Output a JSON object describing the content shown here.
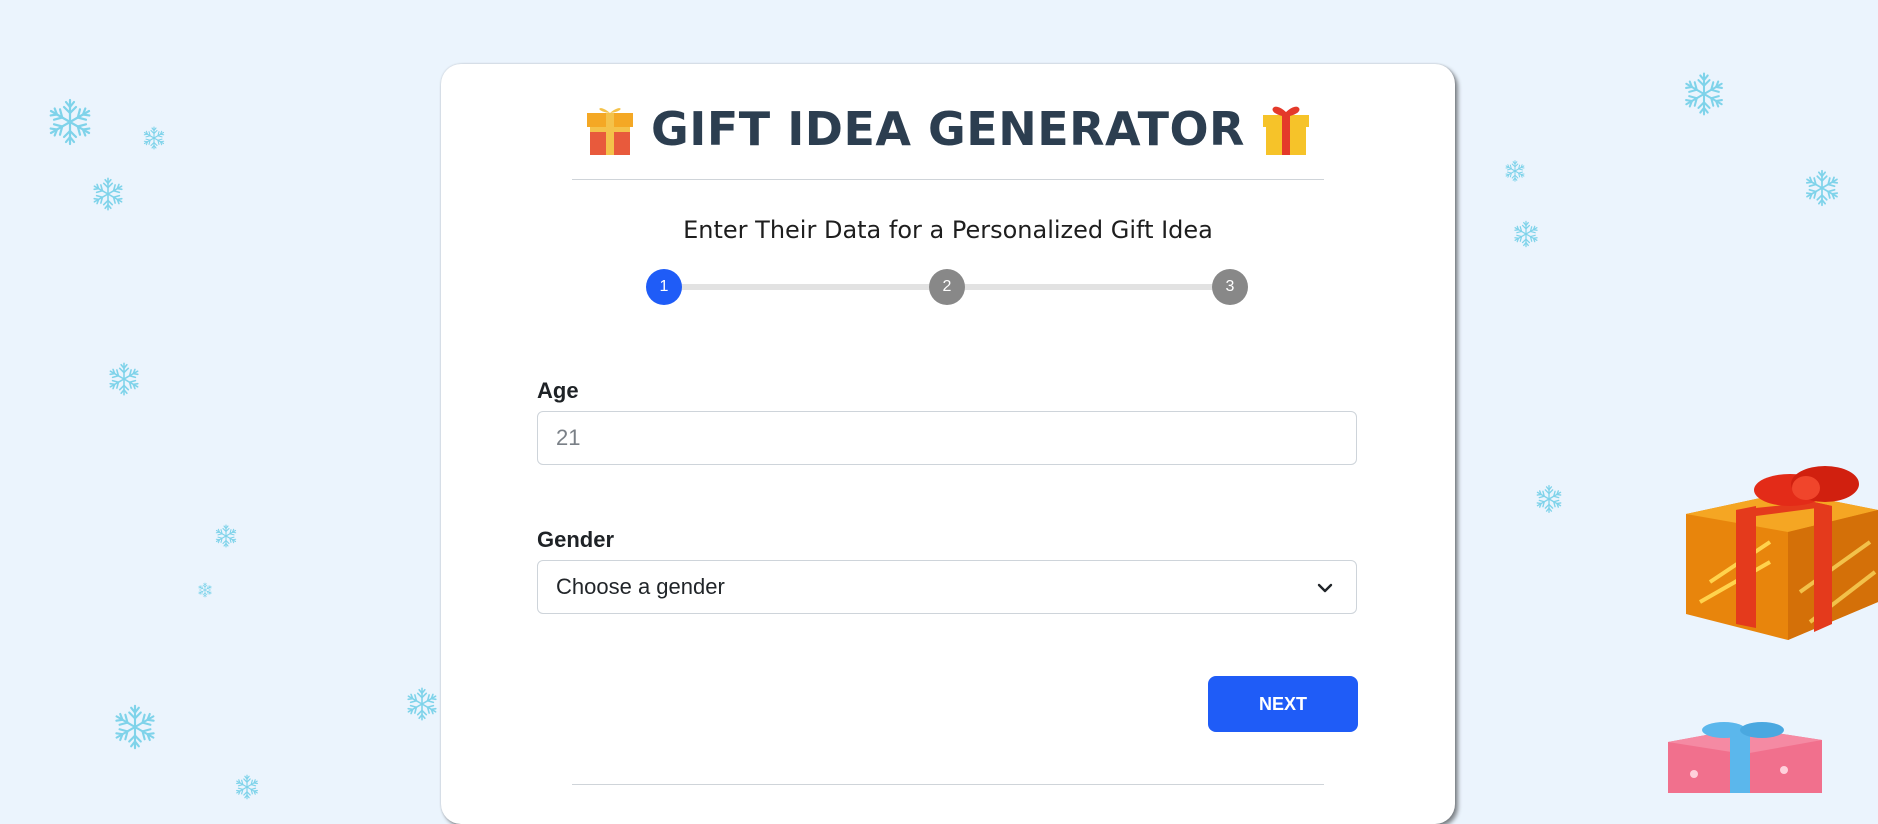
{
  "header": {
    "title": "GIFT IDEA GENERATOR",
    "left_icon": "gift-icon",
    "right_icon": "gift-icon"
  },
  "subtitle": "Enter Their Data for a Personalized Gift Idea",
  "stepper": {
    "steps": [
      "1",
      "2",
      "3"
    ],
    "current_step": 1,
    "active_color": "#1f5cf7",
    "inactive_color": "#888888"
  },
  "form": {
    "age": {
      "label": "Age",
      "placeholder": "21"
    },
    "gender": {
      "label": "Gender",
      "selected": "Choose a gender"
    }
  },
  "buttons": {
    "next": "NEXT"
  },
  "colors": {
    "background": "#ebf4fd",
    "title": "#2c3e50",
    "primary": "#1f5cf7",
    "snowflake": "#7fd3ea"
  }
}
